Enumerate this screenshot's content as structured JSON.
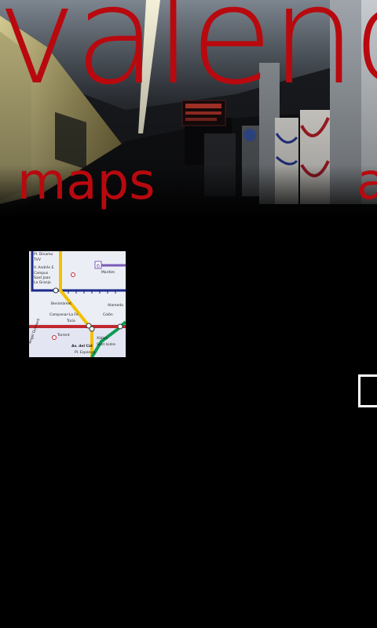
{
  "panorama": {
    "title": "valencia",
    "background_icon": "metro-station-photo"
  },
  "sections": [
    {
      "title": "maps"
    },
    {
      "title": "a"
    }
  ],
  "map_tile": {
    "icon": "metro-map-thumbnail",
    "labels": {
      "l1": "Pl. Dinamo",
      "l2": "TVV",
      "l3": "V. Andrés E.",
      "l4": "Campus",
      "l5": "Sant Joan",
      "l6": "La Granja",
      "l7": "Benimàmet",
      "l8": "Campanar-La Fe",
      "l9": "Túria",
      "l10": "Àngel Guimerà",
      "l11": "Av. del Cid",
      "l12": "Pl. Espanya",
      "l13": "Xàtiva",
      "l14": "Sant Isidre",
      "l15": "Colón",
      "l16": "Alameda",
      "l17": "Marítim",
      "l18": "Torrent",
      "line_badge": "6"
    }
  },
  "colors": {
    "accent": "#b8090f",
    "background": "#000000",
    "line_yellow": "#f2c100",
    "line_blue": "#1b2a8a",
    "line_red": "#c0272d",
    "line_green": "#0f9b57",
    "line_purple": "#7b5bb5"
  }
}
